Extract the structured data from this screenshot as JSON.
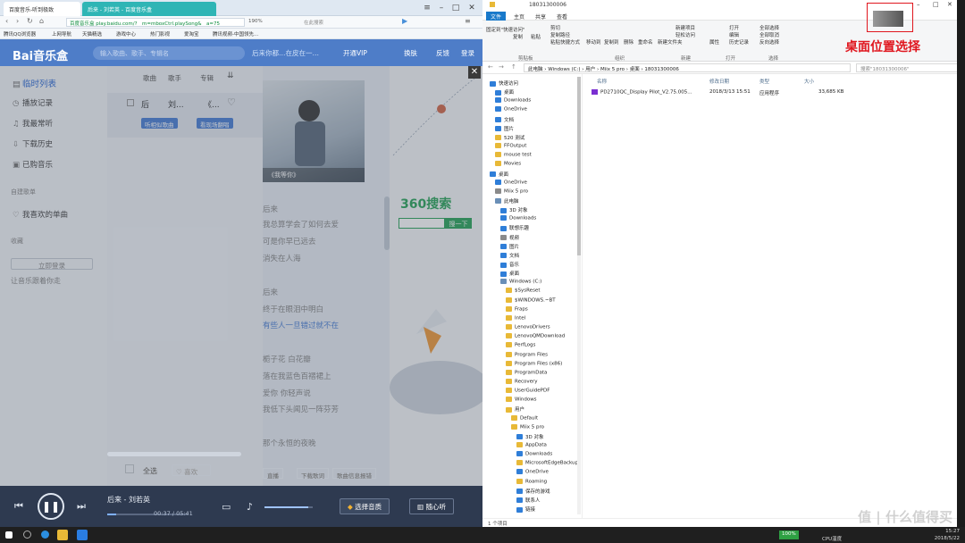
{
  "browser": {
    "tab1": "百度音乐-听到极致",
    "tab2": "后来 - 刘若英 - 百度音乐盒",
    "address": "百度音乐盒  play.baidu.com/?__m=mboxCtrl.playSong&__a=75",
    "zoom": "190%",
    "search_hint": "在此搜索",
    "favorites": [
      "腾讯QQ浏览器",
      "上网导航",
      "天猫精选",
      "游戏中心",
      "热门影视",
      "爱淘宝",
      "腾讯视频-中国领先..."
    ]
  },
  "music": {
    "logo": "Bai音乐盒",
    "search_placeholder": "输入歌曲、歌手、专辑名",
    "header_links": [
      "开通VIP",
      "换肤",
      "反馈",
      "登录"
    ],
    "header_promo": "后来你都…在皮在一…",
    "sidebar": {
      "items": [
        "临时列表",
        "播放记录",
        "我最常听",
        "下载历史",
        "已购音乐"
      ],
      "section_playlists": "自建歌单",
      "fav": "我喜欢的单曲",
      "section_collect": "收藏",
      "login_button": "立即登录",
      "login_hint": "让音乐跟着你走"
    },
    "list_columns": [
      "歌曲",
      "歌手",
      "专辑"
    ],
    "current_song": {
      "title": "后",
      "artist": "刘...",
      "album": "《..."
    },
    "badges": [
      "听相似歌曲",
      "看现场翻唱"
    ],
    "cover_label": "《我等你》",
    "lyrics": [
      "后来",
      "我总算学会了如何去爱",
      "可是你早已远去",
      "消失在人海",
      "后来",
      "终于在眼泪中明白",
      "有些人一旦错过就不在",
      "栀子花 白花瓣",
      "落在我蓝色百褶裙上",
      "爱你 你轻声说",
      "我低下头闻见一阵芬芳",
      "那个永恒的夜晚"
    ],
    "current_lyric_index": 6,
    "ad_search": "360搜索",
    "ad_button": "搜一下",
    "bottom_left": [
      "全选",
      "喜欢"
    ],
    "bottom_right": [
      "直播",
      "下载歌词",
      "歌曲信息报错"
    ],
    "player": {
      "track": "后来 - 刘若英",
      "elapsed": "00:37",
      "total": "05:41",
      "progress": 0.11,
      "volume": 0.9,
      "quality_button": "选择音质",
      "mood_button": "随心听"
    }
  },
  "explorer": {
    "title": "18031300006",
    "ribbon_tabs": [
      "文件",
      "主页",
      "共享",
      "查看"
    ],
    "ribbon_buttons": [
      "固定到\"快速访问\"",
      "复制",
      "粘贴",
      "剪切",
      "复制路径",
      "粘贴快捷方式",
      "移动到",
      "复制到",
      "删除",
      "重命名",
      "新建文件夹",
      "新建项目",
      "轻松访问",
      "属性",
      "打开",
      "编辑",
      "历史记录",
      "全部选择",
      "全部取消",
      "反向选择"
    ],
    "ribbon_groups": [
      "剪贴板",
      "组织",
      "新建",
      "打开",
      "选择"
    ],
    "breadcrumb": [
      "此电脑",
      "Windows (C:)",
      "用户",
      "Miix 5 pro",
      "桌面",
      "18031300006"
    ],
    "search_placeholder": "搜索\"18031300006\"",
    "nav": [
      {
        "label": "快速访问",
        "type": "star"
      },
      {
        "label": "桌面",
        "type": "blue"
      },
      {
        "label": "Downloads",
        "type": "blue"
      },
      {
        "label": "OneDrive",
        "type": "blue"
      },
      {
        "label": "文档",
        "type": "blue"
      },
      {
        "label": "图片",
        "type": "blue"
      },
      {
        "label": "520 测试",
        "type": "fold"
      },
      {
        "label": "FFOutput",
        "type": "fold"
      },
      {
        "label": "mouse test",
        "type": "fold"
      },
      {
        "label": "Movies",
        "type": "fold"
      },
      {
        "label": "桌面",
        "type": "blue"
      },
      {
        "label": "OneDrive",
        "type": "blue"
      },
      {
        "label": "Miix 5 pro",
        "type": "gry"
      },
      {
        "label": "此电脑",
        "type": "drv"
      },
      {
        "label": "3D 对象",
        "type": "blue"
      },
      {
        "label": "Downloads",
        "type": "blue"
      },
      {
        "label": "联想乐趣",
        "type": "blue"
      },
      {
        "label": "视频",
        "type": "gry"
      },
      {
        "label": "图片",
        "type": "blue"
      },
      {
        "label": "文档",
        "type": "blue"
      },
      {
        "label": "音乐",
        "type": "blue"
      },
      {
        "label": "桌面",
        "type": "blue"
      },
      {
        "label": "Windows (C:)",
        "type": "drv"
      },
      {
        "label": "$SysReset",
        "type": "fold"
      },
      {
        "label": "$WINDOWS.~BT",
        "type": "fold"
      },
      {
        "label": "Fraps",
        "type": "fold"
      },
      {
        "label": "Intel",
        "type": "fold"
      },
      {
        "label": "LenovoDrivers",
        "type": "fold"
      },
      {
        "label": "LenovoQMDownload",
        "type": "fold"
      },
      {
        "label": "PerfLogs",
        "type": "fold"
      },
      {
        "label": "Program Files",
        "type": "fold"
      },
      {
        "label": "Program Files (x86)",
        "type": "fold"
      },
      {
        "label": "ProgramData",
        "type": "fold"
      },
      {
        "label": "Recovery",
        "type": "fold"
      },
      {
        "label": "UserGuidePDF",
        "type": "fold"
      },
      {
        "label": "Windows",
        "type": "fold"
      },
      {
        "label": "用户",
        "type": "fold"
      },
      {
        "label": "Default",
        "type": "fold"
      },
      {
        "label": "Miix 5 pro",
        "type": "fold"
      },
      {
        "label": "3D 对象",
        "type": "blue"
      },
      {
        "label": "AppData",
        "type": "fold"
      },
      {
        "label": "Downloads",
        "type": "blue"
      },
      {
        "label": "MicrosoftEdgeBackups",
        "type": "fold"
      },
      {
        "label": "OneDrive",
        "type": "blue"
      },
      {
        "label": "Roaming",
        "type": "fold"
      },
      {
        "label": "保存的游戏",
        "type": "blue"
      },
      {
        "label": "联系人",
        "type": "blue"
      },
      {
        "label": "链接",
        "type": "blue"
      }
    ],
    "columns": [
      "名称",
      "修改日期",
      "类型",
      "大小"
    ],
    "files": [
      {
        "name": "PD2710QC_Display Pilot_V2.75.005...",
        "date": "2018/3/13 15:51",
        "type": "应用程序",
        "size": "33,685 KB"
      }
    ],
    "status": "1 个项目",
    "annotation": "桌面位置选择"
  },
  "taskbar": {
    "battery": "100%",
    "cpu_temp": "CPU温度",
    "time": "15:27",
    "date": "2018/5/22"
  },
  "watermark": "值 | 什么值得买",
  "colors": {
    "accent_blue": "#4e7dc8",
    "player_bg": "#2e3a50",
    "explorer_accent": "#1979ca",
    "annotation": "#e0161e"
  }
}
